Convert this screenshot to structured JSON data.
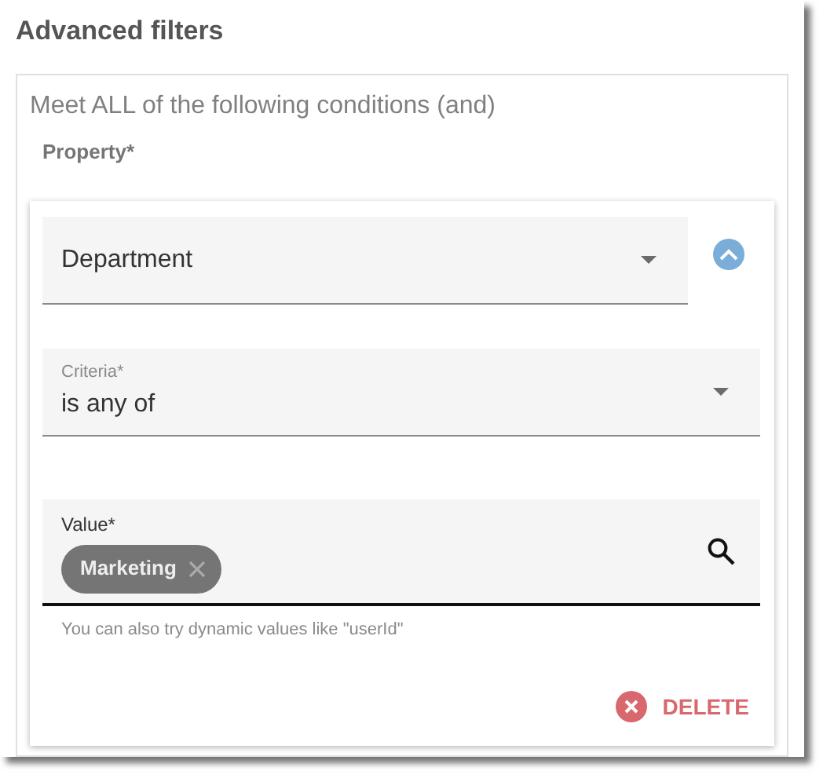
{
  "title": "Advanced filters",
  "group": {
    "description": "Meet ALL of the following conditions (and)",
    "property_label": "Property*",
    "condition": {
      "expanded": true,
      "property": {
        "value": "Department"
      },
      "criteria": {
        "label": "Criteria*",
        "value": "is any of"
      },
      "value": {
        "label": "Value*",
        "chips": [
          "Marketing"
        ],
        "helper": "You can also try dynamic values like \"userId\""
      },
      "delete": {
        "label": "DELETE"
      }
    }
  }
}
